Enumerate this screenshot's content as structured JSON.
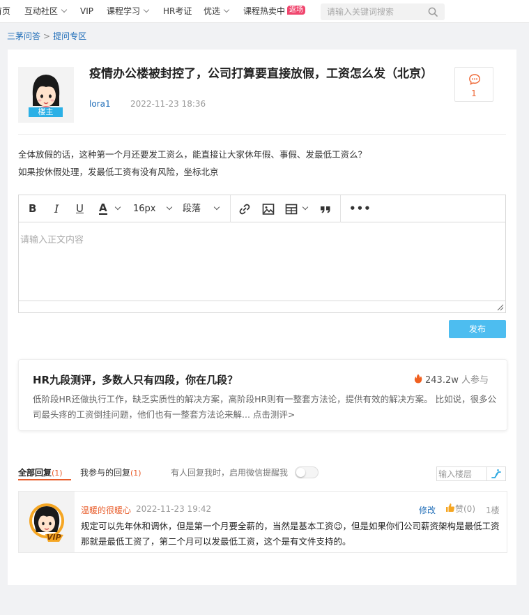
{
  "nav": {
    "items": [
      "首页",
      "互动社区",
      "VIP",
      "课程学习",
      "HR考证",
      "优选",
      "课程热卖中"
    ],
    "hot_badge": "返场",
    "search_placeholder": "请输入关键词搜索"
  },
  "breadcrumb": {
    "root": "三茅问答",
    "separator": ">",
    "current": "提问专区"
  },
  "question": {
    "owner_badge": "楼主",
    "title": "疫情办公楼被封控了，公司打算要直接放假，工资怎么发（北京）",
    "author": "lora1",
    "time": "2022-11-23 18:36",
    "comment_count": "1",
    "body": [
      "全体放假的话，这种第一个月还要发工资么，能直接让大家休年假、事假、发最低工资么？",
      "如果按休假处理，发最低工资有没有风险，坐标北京"
    ]
  },
  "editor": {
    "font_size": "16px",
    "paragraph": "段落",
    "placeholder": "请输入正文内容",
    "publish": "发布"
  },
  "promo": {
    "title": "HR九段测评，多数人只有四段，你在几段？",
    "participants": "243.2w",
    "participants_unit": "人参与",
    "desc": "低阶段HR还做执行工作，缺乏实质性的解决方案，高阶段HR则有一整套方法论，提供有效的解决方案。 比如说，很多公司最头疼的工资倒挂问题，他们也有一整套方法论来解... 点击测评>"
  },
  "tabs": {
    "all_label": "全部回复",
    "all_count": "(1)",
    "mine_label": "我参与的回复",
    "mine_count": "(1)",
    "notify": "有人回复我时，启用微信提醒我",
    "floor_placeholder": "输入楼层"
  },
  "reply": {
    "name": "温暖的很暖心",
    "time": "2022-11-23 19:42",
    "edit": "修改",
    "like": "赞(0)",
    "floor": "1楼",
    "vip_badge": "VIP",
    "body": "规定可以先年休和调休，但是第一个月要全薪的，当然是基本工资😉，但是如果你们公司薪资架构是最低工资那就是最低工资了，第二个月可以发最低工资，这个是有文件支持的。"
  },
  "colors": {
    "accent": "#1f6db8",
    "orange": "#e85c2a",
    "publish": "#4dbdf0",
    "badge": "#2bb0e6",
    "hot": "#f0466e"
  }
}
